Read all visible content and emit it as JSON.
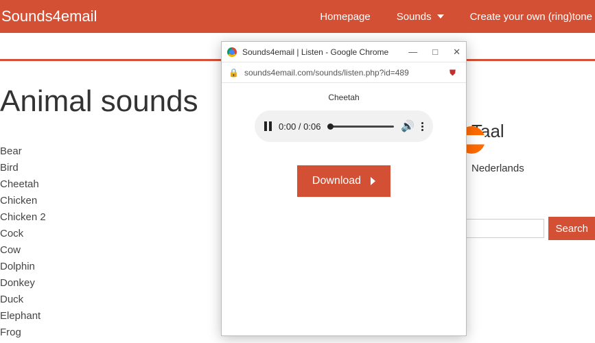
{
  "brand": "Sounds4email",
  "nav": {
    "home": "Homepage",
    "sounds": "Sounds",
    "create": "Create your own (ring)tone"
  },
  "page_title": "Animal sounds",
  "animals": [
    "Bear",
    "Bird",
    "Cheetah",
    "Chicken",
    "Chicken 2",
    "Cock",
    "Cow",
    "Dolphin",
    "Donkey",
    "Duck",
    "Elephant",
    "Frog"
  ],
  "sidebar": {
    "taal_label": "Taal",
    "taal_value": "Nederlands",
    "search_btn": "Search"
  },
  "popup": {
    "window_title": "Sounds4email | Listen - Google Chrome",
    "url": "sounds4email.com/sounds/listen.php?id=489",
    "sound_name": "Cheetah",
    "time": "0:00 / 0:06",
    "download": "Download"
  }
}
